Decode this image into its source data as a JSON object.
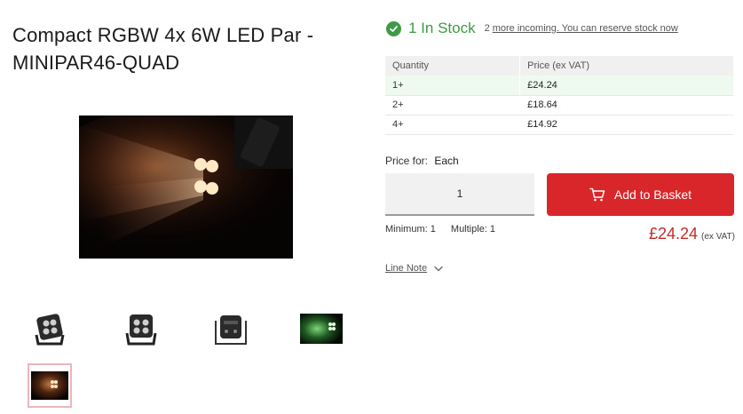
{
  "product": {
    "title": "Compact RGBW 4x 6W LED Par - MINIPAR46-QUAD"
  },
  "gallery": {
    "main_image": "led-par-light-warm-beam",
    "thumbnails": [
      "par-front-angle",
      "par-front-flat",
      "par-rear",
      "par-green-light",
      "par-warm-light-selected"
    ]
  },
  "stock": {
    "icon": "check-circle-icon",
    "status": "1 In Stock",
    "incoming_count": "2",
    "incoming_text": "more incoming. You can reserve stock now",
    "color": "#3f9a46"
  },
  "pricing_table": {
    "headers": [
      "Quantity",
      "Price (ex VAT)"
    ],
    "rows": [
      {
        "qty": "1+",
        "price": "£24.24"
      },
      {
        "qty": "2+",
        "price": "£18.64"
      },
      {
        "qty": "4+",
        "price": "£14.92"
      }
    ]
  },
  "purchase": {
    "price_for_label": "Price for:",
    "price_for_value": "Each",
    "quantity_value": "1",
    "basket_label": "Add to Basket",
    "basket_icon": "cart-icon",
    "minimum": "Minimum: 1",
    "multiple": "Multiple: 1",
    "price": "£24.24",
    "price_note": "(ex VAT)",
    "accent_color": "#d9262b"
  },
  "line_note": {
    "label": "Line Note",
    "icon": "chevron-down-icon"
  }
}
